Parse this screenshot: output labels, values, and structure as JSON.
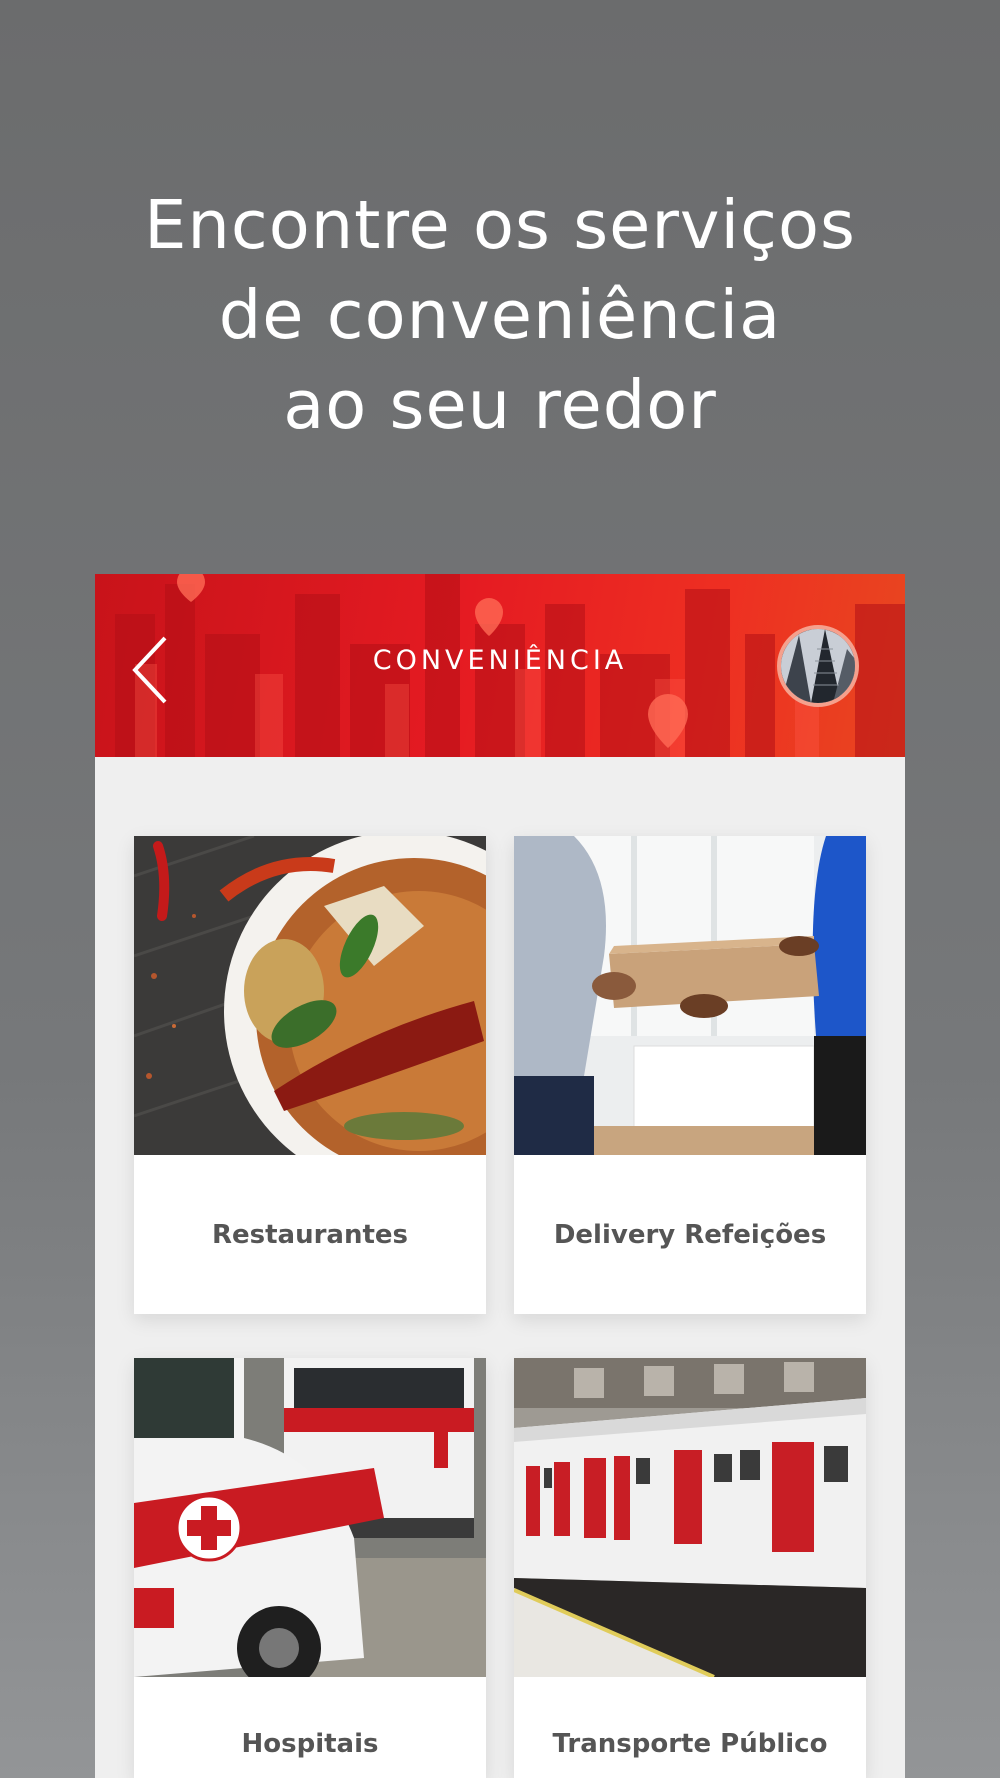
{
  "headline": {
    "lines": [
      "Encontre os serviços",
      "de conveniência",
      "ao seu redor"
    ]
  },
  "appbar": {
    "title": "CONVENIÊNCIA",
    "accent_color": "#e51b22",
    "back_icon": "chevron-left-icon",
    "avatar_icon": "skyscraper-avatar"
  },
  "categories": [
    {
      "label": "Restaurantes",
      "image": "curry-dish-photo"
    },
    {
      "label": "Delivery Refeições",
      "image": "pizza-box-handover-photo"
    },
    {
      "label": "Hospitais",
      "image": "ambulance-photo"
    },
    {
      "label": "Transporte Público",
      "image": "metro-train-photo"
    }
  ]
}
